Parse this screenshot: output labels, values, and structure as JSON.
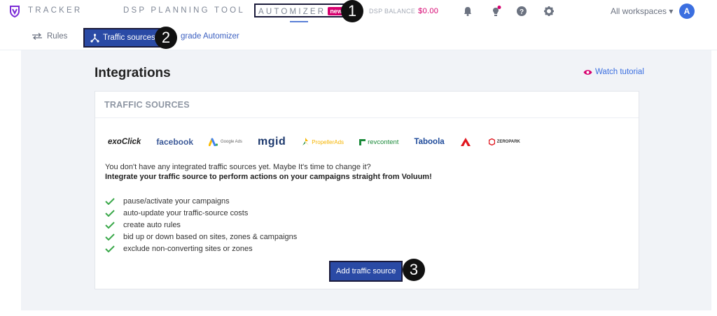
{
  "topnav": {
    "tracker": "TRACKER",
    "dsp_planning": "DSP PLANNING TOOL",
    "automizer": "AUTOMIZER",
    "new_badge": "new",
    "dsp_balance_label": "DSP BALANCE",
    "dsp_balance_value": "$0.00",
    "workspace": "All workspaces ▾",
    "avatar_initial": "A"
  },
  "callouts": [
    "1",
    "2",
    "3"
  ],
  "subnav": {
    "rules": "Rules",
    "traffic_sources": "Traffic sources",
    "upgrade": "grade Automizer"
  },
  "page": {
    "title": "Integrations",
    "watch_tutorial": "Watch tutorial"
  },
  "card": {
    "header": "TRAFFIC SOURCES",
    "logos": [
      "exoClick",
      "facebook",
      "Google Ads",
      "mgid",
      "PropellerAds",
      "revcontent",
      "Taboola",
      "",
      "ZEROPARK"
    ],
    "intro": "You don't have any integrated traffic sources yet. Maybe It's time to change it?",
    "intro_bold": "Integrate your traffic source to perform actions on your campaigns straight from Voluum!",
    "features": [
      "pause/activate your campaigns",
      "auto-update your traffic-source costs",
      "create auto rules",
      "bid up or down based on sites, zones & campaigns",
      "exclude non-converting sites or zones"
    ],
    "add_button": "Add traffic source"
  },
  "colors": {
    "accent": "#2a4aa5",
    "brand_pink": "#d6006f",
    "check_green": "#3aa84a",
    "link_blue": "#3b6fe0"
  }
}
